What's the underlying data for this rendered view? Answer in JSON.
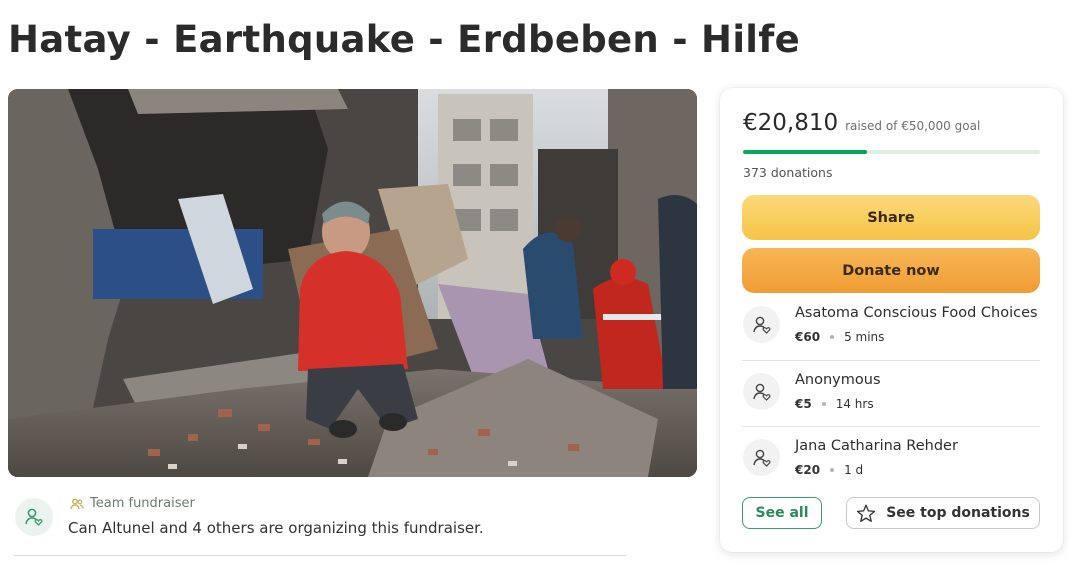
{
  "page": {
    "title": "Hatay - Earthquake - Erdbeben - Hilfe"
  },
  "hero": {
    "description": "Photo of a woman in a red jacket crouching in earthquake rubble"
  },
  "organizer": {
    "kicker": "Team fundraiser",
    "text": "Can Altunel and 4 others are organizing this fundraiser.",
    "icon": "user-heart-icon"
  },
  "donation_card": {
    "raised_amount": "€20,810",
    "raised_label": "raised of €50,000 goal",
    "progress_fraction": 0.4162,
    "donations_count": "373 donations",
    "share_label": "Share",
    "donate_label": "Donate now",
    "donors": [
      {
        "name": "Asatoma Conscious Food Choices",
        "amount": "€60",
        "time": "5 mins"
      },
      {
        "name": "Anonymous",
        "amount": "€5",
        "time": "14 hrs"
      },
      {
        "name": "Jana Catharina Rehder",
        "amount": "€20",
        "time": "1 d"
      }
    ],
    "see_all_label": "See all",
    "see_top_label": "See top donations"
  },
  "colors": {
    "brand_green": "#02a95c",
    "share_yellow": "#f6c445",
    "donate_orange": "#f09d34"
  }
}
